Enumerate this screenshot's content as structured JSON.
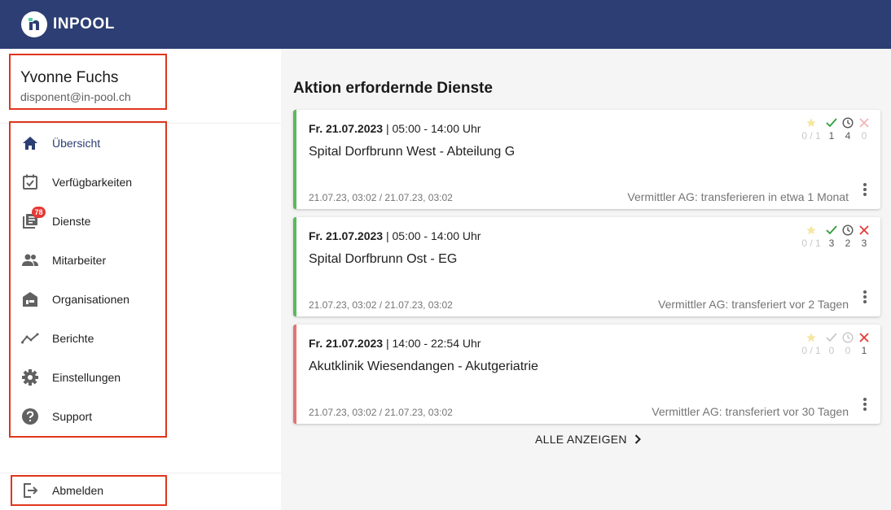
{
  "app": {
    "logo_text": "INPOOL",
    "brand_color": "#2c3e73"
  },
  "user": {
    "name": "Yvonne Fuchs",
    "email": "disponent@in-pool.ch"
  },
  "nav": {
    "items": [
      {
        "label": "Übersicht",
        "icon": "home-icon"
      },
      {
        "label": "Verfügbarkeiten",
        "icon": "calendar-check-icon"
      },
      {
        "label": "Dienste",
        "icon": "shifts-icon",
        "badge": "78"
      },
      {
        "label": "Mitarbeiter",
        "icon": "people-icon"
      },
      {
        "label": "Organisationen",
        "icon": "building-icon"
      },
      {
        "label": "Berichte",
        "icon": "trending-icon"
      },
      {
        "label": "Einstellungen",
        "icon": "gear-icon"
      },
      {
        "label": "Support",
        "icon": "help-icon"
      }
    ],
    "logout": "Abmelden"
  },
  "main": {
    "title": "Aktion erfordernde Dienste",
    "show_all": "ALLE ANZEIGEN",
    "cards": [
      {
        "date": "Fr. 21.07.2023",
        "time": " | 05:00 - 14:00 Uhr",
        "title": "Spital Dorfbrunn West - Abteilung G",
        "stamp": "21.07.23, 03:02 / 21.07.23, 03:02",
        "status": "Vermittler AG: transferieren in etwa 1 Monat",
        "stars": "0 / 1",
        "accepted": "1",
        "pending": "4",
        "declined": "0",
        "accent": "#5cb85c"
      },
      {
        "date": "Fr. 21.07.2023",
        "time": " | 05:00 - 14:00 Uhr",
        "title": "Spital Dorfbrunn Ost - EG",
        "stamp": "21.07.23, 03:02 / 21.07.23, 03:02",
        "status": "Vermittler AG: transferiert vor 2 Tagen",
        "stars": "0 / 1",
        "accepted": "3",
        "pending": "2",
        "declined": "3",
        "accent": "#5cb85c"
      },
      {
        "date": "Fr. 21.07.2023",
        "time": " | 14:00 - 22:54 Uhr",
        "title": "Akutklinik Wiesendangen - Akutgeriatrie",
        "stamp": "21.07.23, 03:02 / 21.07.23, 03:02",
        "status": "Vermittler AG: transferiert vor 30 Tagen",
        "stars": "0 / 1",
        "accepted": "0",
        "pending": "0",
        "declined": "1",
        "accent": "#e57373"
      }
    ]
  }
}
